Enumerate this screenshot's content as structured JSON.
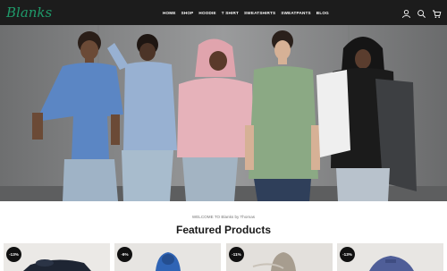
{
  "header": {
    "logo_text": "Blanks",
    "nav": [
      "HOME",
      "SHOP",
      "HOODIE",
      "T SHIRT",
      "SWEATSHIRTS",
      "SWEATPANTS",
      "BLOG"
    ],
    "icons": [
      "user-icon",
      "search-icon",
      "cart-icon"
    ]
  },
  "hero": {
    "image": "five models wearing blank hoodies and t-shirts against a concrete wall"
  },
  "welcome_text": "WELCOME TO Blanks by Thomas",
  "section_title": "Featured Products",
  "products": [
    {
      "badge": "-13%"
    },
    {
      "badge": "-9%"
    },
    {
      "badge": "-11%"
    },
    {
      "badge": "-13%"
    }
  ],
  "colors": {
    "header_bg": "#1c1c1c",
    "logo": "#1f9a6a",
    "badge_bg": "#111111"
  }
}
